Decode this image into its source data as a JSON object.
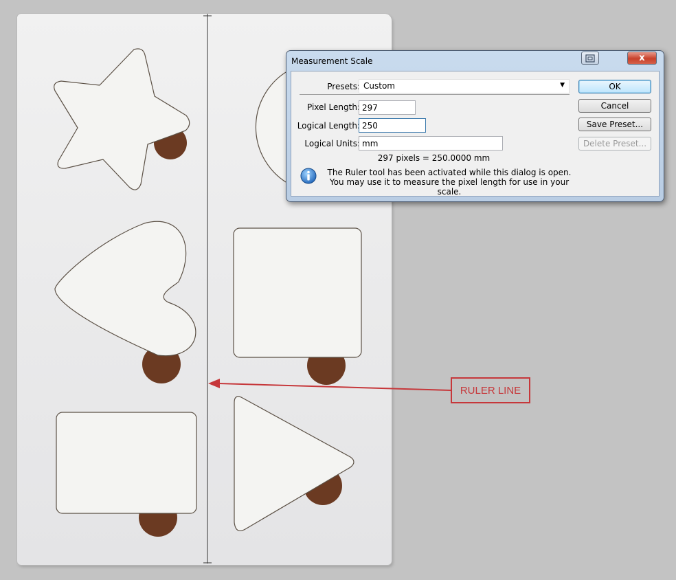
{
  "dialog": {
    "title": "Measurement Scale",
    "presets_label": "Presets:",
    "presets_value": "Custom",
    "pixel_length_label": "Pixel Length:",
    "pixel_length_value": "297",
    "logical_length_label": "Logical Length:",
    "logical_length_value": "250",
    "logical_units_label": "Logical Units:",
    "logical_units_value": "mm",
    "equation": "297 pixels = 250.0000 mm",
    "info_line1": "The Ruler tool has been activated while this dialog is open.",
    "info_line2": "You may use it to measure the pixel length for use in your scale.",
    "buttons": {
      "ok": "OK",
      "cancel": "Cancel",
      "save_preset": "Save Preset...",
      "delete_preset": "Delete Preset..."
    },
    "close_glyph": "x"
  },
  "annotation": {
    "label": "RULER LINE",
    "color": "#c6373a"
  },
  "icons": {
    "info": "info-icon",
    "help": "help-icon",
    "close": "close-icon",
    "dropdown": "chevron-down-icon"
  },
  "colors": {
    "background": "#c3c3c3",
    "board": "#ececee",
    "peg": "#6b3a22"
  }
}
